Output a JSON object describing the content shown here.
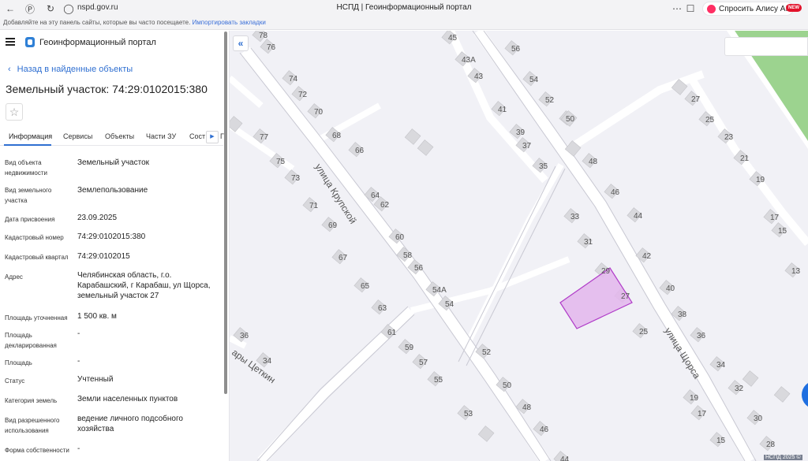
{
  "browser": {
    "url": "nspd.gov.ru",
    "tab_title": "НСПД | Геоинформационный портал",
    "alisa_label": "Спросить Алису AI",
    "bookmark_text": "Добавляйте на эту панель сайты, которые вы часто посещаете.",
    "bookmark_link": "Импортировать закладки",
    "new_badge": "NEW"
  },
  "header": {
    "portal_title": "Геоинформационный портал"
  },
  "back_link": "Назад в найденные объекты",
  "page_title": "Земельный участок: 74:29:0102015:380",
  "tabs": [
    {
      "label": "Информация"
    },
    {
      "label": "Сервисы"
    },
    {
      "label": "Объекты"
    },
    {
      "label": "Части ЗУ"
    },
    {
      "label": "Соста"
    },
    {
      "label": "Г"
    }
  ],
  "properties": [
    {
      "label": "Вид объекта недвижимости",
      "value": "Земельный участок"
    },
    {
      "label": "Вид земельного участка",
      "value": "Землепользование"
    },
    {
      "label": "Дата присвоения",
      "value": "23.09.2025"
    },
    {
      "label": "Кадастровый номер",
      "value": "74:29:0102015:380"
    },
    {
      "label": "Кадастровый квартал",
      "value": "74:29:0102015"
    },
    {
      "label": "Адрес",
      "value": "Челябинская область, г.о. Карабашский, г Карабаш, ул Щорса, земельный участок 27"
    },
    {
      "label": "Площадь уточненная",
      "value": "1 500 кв. м"
    },
    {
      "label": "Площадь декларированная",
      "value": "-"
    },
    {
      "label": "Площадь",
      "value": "-"
    },
    {
      "label": "Статус",
      "value": "Учтенный"
    },
    {
      "label": "Категория земель",
      "value": "Земли населенных пунктов"
    },
    {
      "label": "Вид разрешенного использования",
      "value": "ведение личного подсобного хозяйства"
    },
    {
      "label": "Форма собственности",
      "value": "-"
    }
  ],
  "map": {
    "streets": [
      "улица Крупской",
      "улица Щорса",
      "ары Цеткин"
    ],
    "house_numbers": [
      "78",
      "76",
      "74",
      "72",
      "70",
      "68",
      "66",
      "77",
      "75",
      "73",
      "71",
      "69",
      "67",
      "65",
      "64",
      "62",
      "60",
      "58",
      "56",
      "54А",
      "54",
      "63",
      "61",
      "59",
      "57",
      "55",
      "53",
      "36",
      "34",
      "45",
      "43А",
      "43",
      "41",
      "39",
      "37",
      "35",
      "56",
      "54",
      "52",
      "50",
      "48",
      "46",
      "44",
      "42",
      "40",
      "38",
      "36",
      "34",
      "32",
      "30",
      "28",
      "33",
      "31",
      "29",
      "27",
      "25",
      "52",
      "50",
      "48",
      "46",
      "44",
      "27",
      "25",
      "23",
      "21",
      "19",
      "17",
      "15",
      "13",
      "19",
      "17",
      "15"
    ],
    "colors": {
      "parcel_fill": "#e3b6ec",
      "parcel_stroke": "#b03cc8",
      "park": "#9cd38f"
    },
    "copyright": "НСПД 2025 ©"
  }
}
